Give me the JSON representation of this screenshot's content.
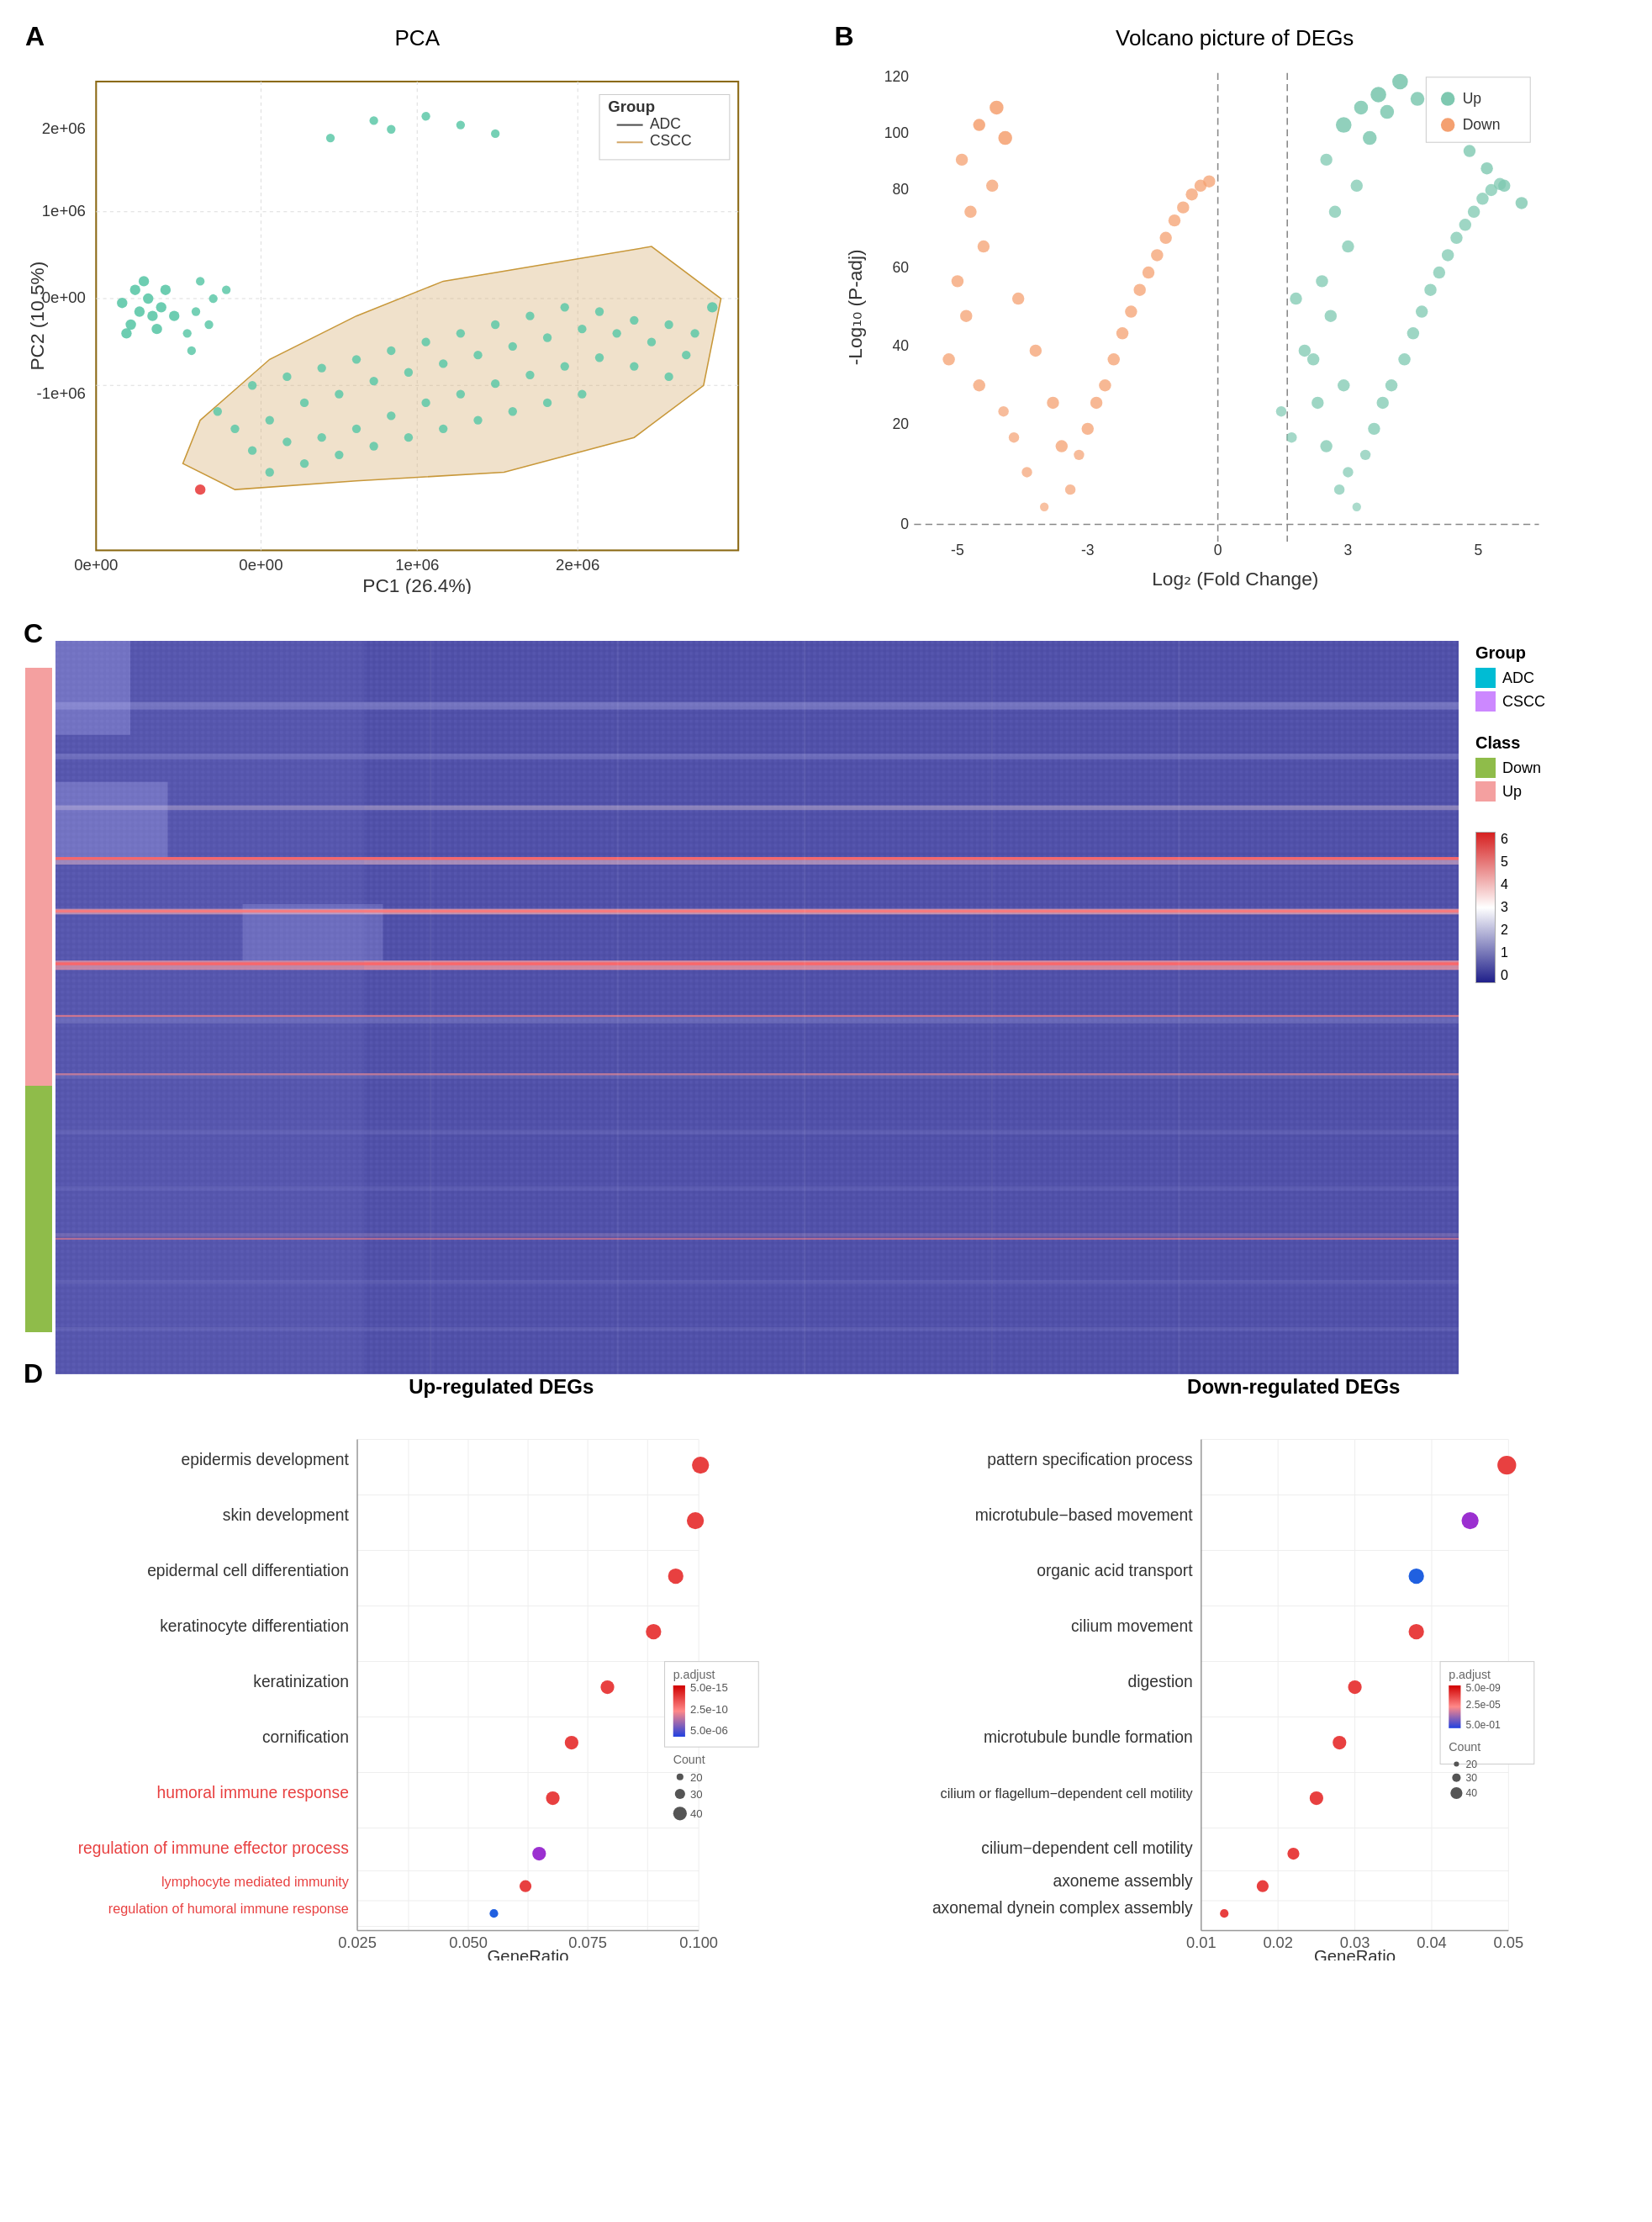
{
  "panels": {
    "a": {
      "label": "A",
      "title": "PCA",
      "x_axis": "PC1 (26.4%)",
      "y_axis": "PC2 (10.5%)",
      "legend": {
        "title": "Group",
        "items": [
          {
            "name": "ADC",
            "color": "#4e4e4e",
            "shape": "line"
          },
          {
            "name": "CSCC",
            "color": "#d4a96a",
            "shape": "line"
          }
        ]
      }
    },
    "b": {
      "label": "B",
      "title": "Volcano picture of DEGs",
      "x_axis": "Log₂ (Fold Change)",
      "y_axis": "-Log₁₀ (P-adj)",
      "legend": {
        "items": [
          {
            "name": "Up",
            "color": "#7ec8b0"
          },
          {
            "name": "Down",
            "color": "#f4a070"
          }
        ]
      }
    },
    "c": {
      "label": "C",
      "legend": {
        "group_title": "Group",
        "groups": [
          {
            "name": "ADC",
            "color": "#00bcd4"
          },
          {
            "name": "CSCC",
            "color": "#cc88ff"
          }
        ],
        "class_title": "Class",
        "classes": [
          {
            "name": "Down",
            "color": "#8fbc4a"
          },
          {
            "name": "Up",
            "color": "#f4a0a0"
          }
        ],
        "scale_values": [
          "6",
          "5",
          "4",
          "3",
          "2",
          "1",
          "0"
        ]
      }
    },
    "d": {
      "label": "D",
      "up_title": "Up-regulated DEGs",
      "down_title": "Down-regulated DEGs",
      "up_x_axis": "GeneRatio",
      "down_x_axis": "GeneRatio",
      "up_x_ticks": [
        "0.025",
        "0.050",
        "0.075",
        "0.100"
      ],
      "down_x_ticks": [
        "0.01",
        "0.02",
        "0.03",
        "0.04",
        "0.05"
      ],
      "up_terms": [
        {
          "name": "epidermis development",
          "ratio": 0.107,
          "pval": "low",
          "count": 5,
          "color": "#e84040"
        },
        {
          "name": "skin development",
          "ratio": 0.105,
          "pval": "low",
          "count": 5,
          "color": "#e84040"
        },
        {
          "name": "epidermal cell differentiation",
          "ratio": 0.095,
          "pval": "low",
          "count": 4,
          "color": "#e84040"
        },
        {
          "name": "keratinocyte differentiation",
          "ratio": 0.09,
          "pval": "low",
          "count": 4,
          "color": "#e84040"
        },
        {
          "name": "keratinization",
          "ratio": 0.08,
          "pval": "mid",
          "count": 3,
          "color": "#e84040"
        },
        {
          "name": "cornification",
          "ratio": 0.072,
          "pval": "mid",
          "count": 3,
          "color": "#e84040"
        },
        {
          "name": "humoral immune response",
          "ratio": 0.068,
          "pval": "low",
          "count": 3,
          "color": "#e84040",
          "red_label": true
        },
        {
          "name": "regulation of immune effector process",
          "ratio": 0.065,
          "pval": "high",
          "count": 3,
          "color": "#9b30d0",
          "red_label": true
        },
        {
          "name": "lymphocyte mediated immunity",
          "ratio": 0.062,
          "pval": "low",
          "count": 3,
          "color": "#e84040",
          "red_label": true
        },
        {
          "name": "regulation of humoral immune response",
          "ratio": 0.055,
          "pval": "high",
          "count": 2,
          "color": "#2060e0",
          "red_label": true
        }
      ],
      "down_terms": [
        {
          "name": "pattern specification process",
          "ratio": 0.055,
          "pval": "low",
          "count": 5,
          "color": "#e84040"
        },
        {
          "name": "microtubule-based movement",
          "ratio": 0.045,
          "pval": "mid",
          "count": 4,
          "color": "#9b30d0"
        },
        {
          "name": "organic acid transport",
          "ratio": 0.038,
          "pval": "mid",
          "count": 4,
          "color": "#2060e0"
        },
        {
          "name": "cilium movement",
          "ratio": 0.038,
          "pval": "low",
          "count": 4,
          "color": "#e84040"
        },
        {
          "name": "digestion",
          "ratio": 0.03,
          "pval": "low",
          "count": 3,
          "color": "#e84040"
        },
        {
          "name": "microtubule bundle formation",
          "ratio": 0.028,
          "pval": "low",
          "count": 3,
          "color": "#e84040"
        },
        {
          "name": "cilium or flagellum-dependent cell motility",
          "ratio": 0.025,
          "pval": "low",
          "count": 3,
          "color": "#e84040"
        },
        {
          "name": "cilium-dependent cell motility",
          "ratio": 0.022,
          "pval": "low",
          "count": 3,
          "color": "#e84040"
        },
        {
          "name": "axoneme assembly",
          "ratio": 0.018,
          "pval": "low",
          "count": 3,
          "color": "#e84040"
        },
        {
          "name": "axonemal dynein complex assembly",
          "ratio": 0.013,
          "pval": "low",
          "count": 2,
          "color": "#e84040"
        }
      ]
    }
  }
}
